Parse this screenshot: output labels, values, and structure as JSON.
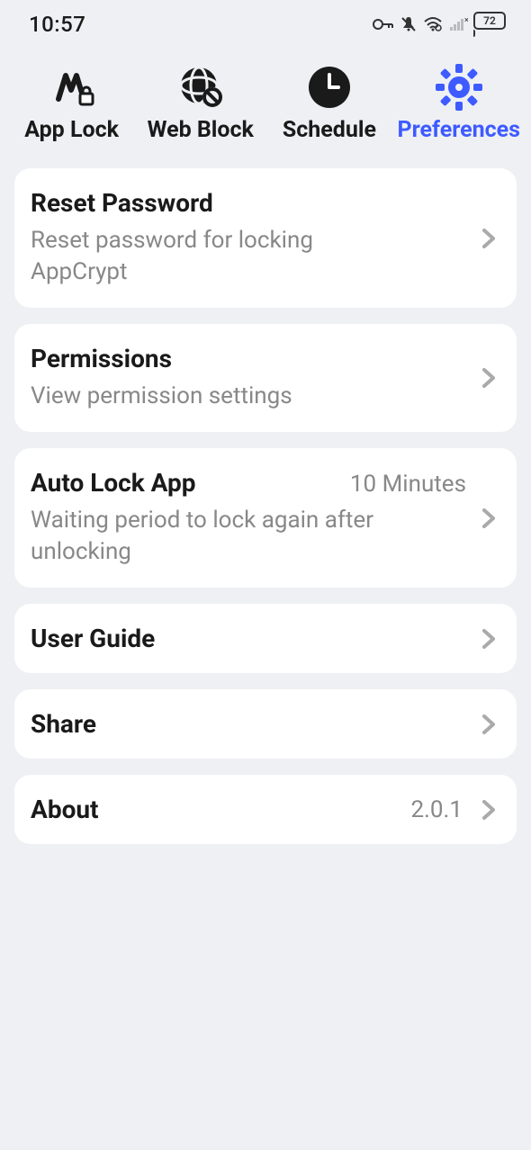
{
  "status": {
    "time": "10:57",
    "battery": "72"
  },
  "tabs": [
    {
      "label": "App Lock"
    },
    {
      "label": "Web Block"
    },
    {
      "label": "Schedule"
    },
    {
      "label": "Preferences"
    }
  ],
  "prefs": {
    "reset": {
      "title": "Reset Password",
      "sub": "Reset password for locking AppCrypt"
    },
    "permissions": {
      "title": "Permissions",
      "sub": "View permission settings"
    },
    "autolock": {
      "title": "Auto Lock App",
      "value": "10 Minutes",
      "sub": "Waiting period to lock again after unlocking"
    },
    "guide": {
      "title": "User Guide"
    },
    "share": {
      "title": "Share"
    },
    "about": {
      "title": "About",
      "value": "2.0.1"
    }
  }
}
